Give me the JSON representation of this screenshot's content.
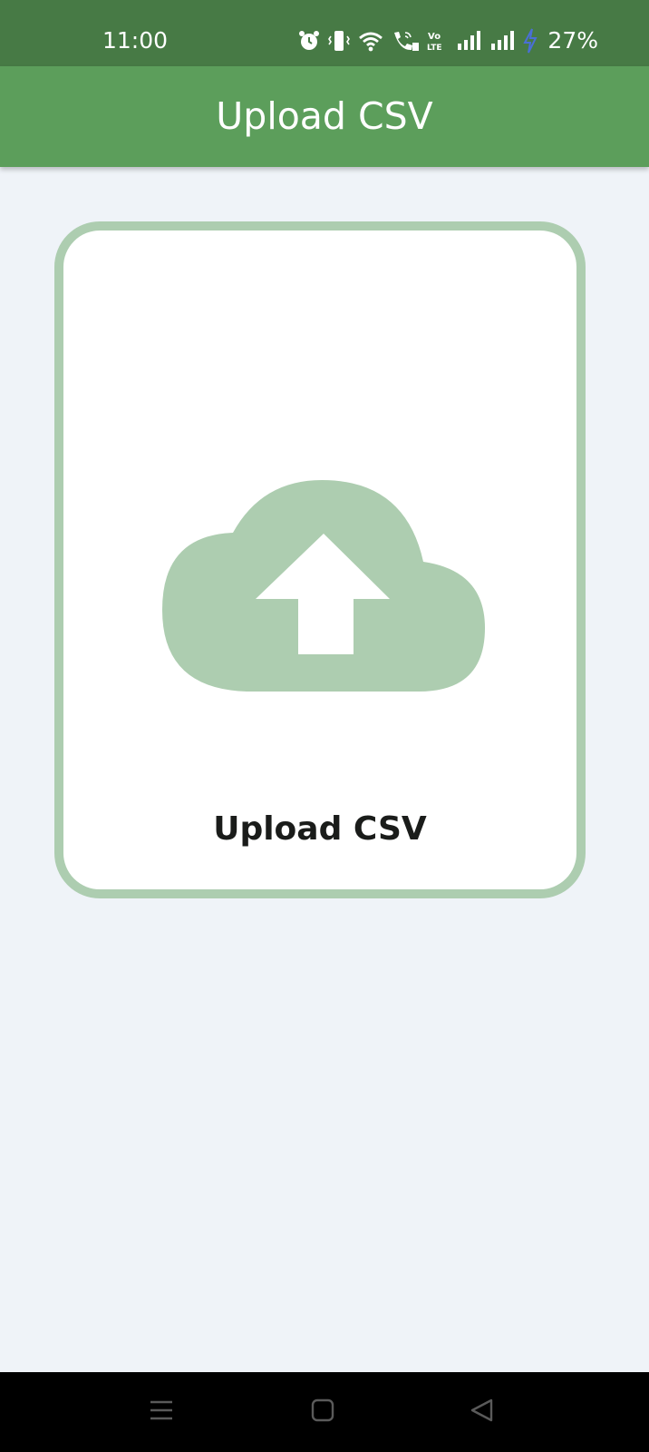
{
  "status_bar": {
    "time": "11:00",
    "battery": "27%",
    "icons": [
      "alarm-icon",
      "vibrate-icon",
      "wifi-icon",
      "wifi-calling-icon",
      "volte-icon",
      "signal-sim1-icon",
      "signal-sim2-icon",
      "charging-icon"
    ],
    "colors": {
      "background": "#477a45",
      "charging": "#4a6fd6"
    }
  },
  "app_bar": {
    "title": "Upload CSV",
    "color": "#5c9e5b"
  },
  "upload_card": {
    "label": "Upload CSV",
    "icon": "cloud-upload-icon",
    "colors": {
      "border": "#adcdb0",
      "icon": "#adcdb0"
    }
  },
  "nav_bar": {
    "buttons": [
      "menu-icon",
      "home-icon",
      "back-icon"
    ]
  },
  "colors": {
    "page_background": "#eff3f8"
  }
}
